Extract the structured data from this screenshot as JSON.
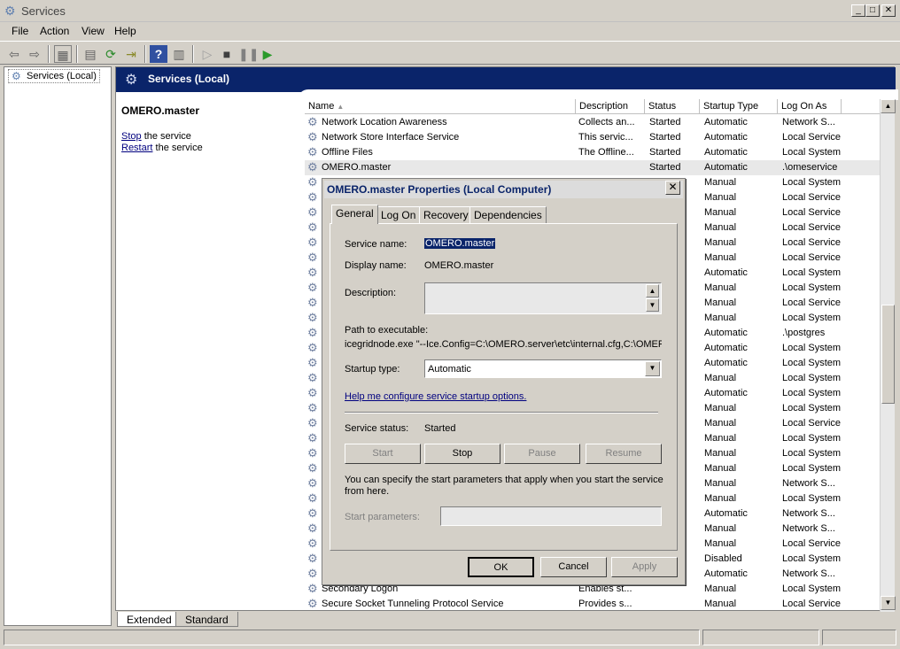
{
  "window": {
    "title": "Services"
  },
  "menu": [
    "File",
    "Action",
    "View",
    "Help"
  ],
  "tree": {
    "root": "Services (Local)"
  },
  "pane_header": "Services (Local)",
  "detail": {
    "service_name": "OMERO.master",
    "stop_link": "Stop",
    "stop_rest": " the service",
    "restart_link": "Restart",
    "restart_rest": " the service"
  },
  "columns": [
    "Name",
    "Description",
    "Status",
    "Startup Type",
    "Log On As"
  ],
  "rows": [
    {
      "name": "Network Location Awareness",
      "desc": "Collects an...",
      "status": "Started",
      "startup": "Automatic",
      "logon": "Network S..."
    },
    {
      "name": "Network Store Interface Service",
      "desc": "This servic...",
      "status": "Started",
      "startup": "Automatic",
      "logon": "Local Service"
    },
    {
      "name": "Offline Files",
      "desc": "The Offline...",
      "status": "Started",
      "startup": "Automatic",
      "logon": "Local System"
    },
    {
      "name": "OMERO.master",
      "desc": "",
      "status": "Started",
      "startup": "Automatic",
      "logon": ".\\omeservice",
      "selected": true
    },
    {
      "name": "",
      "desc": "",
      "status": "",
      "startup": "Manual",
      "logon": "Local System"
    },
    {
      "name": "",
      "desc": "",
      "status": "",
      "startup": "Manual",
      "logon": "Local Service"
    },
    {
      "name": "",
      "desc": "",
      "status": "",
      "startup": "Manual",
      "logon": "Local Service"
    },
    {
      "name": "",
      "desc": "",
      "status": "",
      "startup": "Manual",
      "logon": "Local Service"
    },
    {
      "name": "",
      "desc": "",
      "status": "",
      "startup": "Manual",
      "logon": "Local Service"
    },
    {
      "name": "",
      "desc": "",
      "status": "",
      "startup": "Manual",
      "logon": "Local Service"
    },
    {
      "name": "",
      "desc": "",
      "status": "",
      "startup": "Automatic",
      "logon": "Local System"
    },
    {
      "name": "",
      "desc": "",
      "status": "",
      "startup": "Manual",
      "logon": "Local System"
    },
    {
      "name": "",
      "desc": "",
      "status": "",
      "startup": "Manual",
      "logon": "Local Service"
    },
    {
      "name": "",
      "desc": "",
      "status": "",
      "startup": "Manual",
      "logon": "Local System"
    },
    {
      "name": "",
      "desc": "",
      "status": "",
      "startup": "Automatic",
      "logon": ".\\postgres"
    },
    {
      "name": "",
      "desc": "",
      "status": "",
      "startup": "Automatic",
      "logon": "Local System"
    },
    {
      "name": "",
      "desc": "",
      "status": "",
      "startup": "Automatic",
      "logon": "Local System"
    },
    {
      "name": "",
      "desc": "",
      "status": "",
      "startup": "Manual",
      "logon": "Local System"
    },
    {
      "name": "",
      "desc": "",
      "status": "",
      "startup": "Automatic",
      "logon": "Local System"
    },
    {
      "name": "",
      "desc": "",
      "status": "",
      "startup": "Manual",
      "logon": "Local System"
    },
    {
      "name": "",
      "desc": "",
      "status": "",
      "startup": "Manual",
      "logon": "Local Service"
    },
    {
      "name": "",
      "desc": "",
      "status": "",
      "startup": "Manual",
      "logon": "Local System"
    },
    {
      "name": "",
      "desc": "",
      "status": "",
      "startup": "Manual",
      "logon": "Local System"
    },
    {
      "name": "",
      "desc": "",
      "status": "",
      "startup": "Manual",
      "logon": "Local System"
    },
    {
      "name": "",
      "desc": "",
      "status": "",
      "startup": "Manual",
      "logon": "Network S..."
    },
    {
      "name": "",
      "desc": "",
      "status": "",
      "startup": "Manual",
      "logon": "Local System"
    },
    {
      "name": "",
      "desc": "",
      "status": "",
      "startup": "Automatic",
      "logon": "Network S..."
    },
    {
      "name": "",
      "desc": "",
      "status": "",
      "startup": "Manual",
      "logon": "Network S..."
    },
    {
      "name": "",
      "desc": "",
      "status": "",
      "startup": "Manual",
      "logon": "Local Service"
    },
    {
      "name": "",
      "desc": "",
      "status": "",
      "startup": "Disabled",
      "logon": "Local System"
    },
    {
      "name": "",
      "desc": "",
      "status": "",
      "startup": "Automatic",
      "logon": "Network S..."
    },
    {
      "name": "Secondary Logon",
      "desc": "Enables st...",
      "status": "",
      "startup": "Manual",
      "logon": "Local System"
    },
    {
      "name": "Secure Socket Tunneling Protocol Service",
      "desc": "Provides s...",
      "status": "",
      "startup": "Manual",
      "logon": "Local Service"
    }
  ],
  "bottom_tabs": [
    "Extended",
    "Standard"
  ],
  "dialog": {
    "title": "OMERO.master Properties (Local Computer)",
    "tabs": [
      "General",
      "Log On",
      "Recovery",
      "Dependencies"
    ],
    "service_name_label": "Service name:",
    "service_name_value": "OMERO.master",
    "display_name_label": "Display name:",
    "display_name_value": "OMERO.master",
    "description_label": "Description:",
    "path_label": "Path to executable:",
    "path_value": "icegridnode.exe \"--Ice.Config=C:\\OMERO.server\\etc\\internal.cfg,C:\\OMER",
    "startup_type_label": "Startup type:",
    "startup_type_value": "Automatic",
    "help_link": "Help me configure service startup options.",
    "status_label": "Service status:",
    "status_value": "Started",
    "btn_start": "Start",
    "btn_stop": "Stop",
    "btn_pause": "Pause",
    "btn_resume": "Resume",
    "params_note": "You can specify the start parameters that apply when you start the service from here.",
    "params_label": "Start parameters:",
    "ok": "OK",
    "cancel": "Cancel",
    "apply": "Apply"
  }
}
